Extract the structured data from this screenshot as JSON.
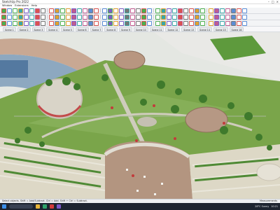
{
  "window": {
    "title": "SketchUp Pro 2022",
    "controls": [
      "–",
      "□",
      "×"
    ]
  },
  "menu": {
    "items": [
      "Window",
      "Extensions",
      "Help"
    ]
  },
  "toolbars": {
    "row1_icons": [
      "select-icon",
      "eraser-icon",
      "paint-icon",
      "line-icon",
      "arc-icon",
      "rectangle-icon",
      "circle-icon",
      "polygon-icon",
      "push-pull-icon",
      "move-icon",
      "rotate-icon",
      "scale-icon",
      "offset-icon",
      "tape-icon",
      "dimension-icon",
      "protractor-icon",
      "text-icon",
      "axes-icon",
      "3d-text-icon",
      "orbit-icon",
      "pan-icon",
      "zoom-icon",
      "zoom-extents-icon",
      "walk-icon",
      "look-around-icon",
      "section-icon",
      "component-icon",
      "group-icon",
      "layer-icon",
      "shadow-icon",
      "fog-icon",
      "style-icon",
      "scene-icon",
      "match-photo-icon",
      "sandbox-icon",
      "warehouse-icon",
      "extension-icon",
      "layout-icon",
      "styles-icon",
      "info-icon",
      "settings-icon",
      "help-icon"
    ],
    "row2_icons": [
      "iso-view-icon",
      "top-view-icon",
      "front-view-icon",
      "right-view-icon",
      "back-view-icon",
      "left-view-icon",
      "xray-icon",
      "back-edges-icon",
      "wireframe-icon",
      "hidden-line-icon",
      "shaded-icon",
      "textured-icon",
      "monochrome-icon",
      "section-plane-icon",
      "section-cut-icon",
      "section-fill-icon",
      "solid-union-icon",
      "solid-subtract-icon",
      "solid-trim-icon",
      "solid-intersect-icon",
      "outer-shell-icon",
      "split-icon",
      "curve-icon",
      "bezier-icon",
      "spline-icon",
      "joint-push-icon",
      "round-corner-icon",
      "shape-bender-icon",
      "follow-me-icon",
      "soften-icon",
      "smooth-icon",
      "weld-icon",
      "profile-icon",
      "extrude-icon",
      "loft-icon",
      "skin-icon",
      "quad-icon",
      "subdivide-icon",
      "random-icon",
      "array-icon",
      "mirror-icon",
      "align-icon"
    ],
    "row3_icons": [
      "tag-icon",
      "material-icon",
      "entity-icon",
      "outliner-icon",
      "components-icon",
      "scenes-icon",
      "styles-panel-icon",
      "shadows-panel-icon",
      "fog-panel-icon",
      "soften-panel-icon",
      "instructor-icon",
      "tray-icon",
      "render-icon",
      "light-icon",
      "camera-icon",
      "export-icon",
      "import-icon",
      "print-icon",
      "save-icon",
      "open-icon",
      "new-icon",
      "undo-icon",
      "redo-icon",
      "cut-icon",
      "copy-icon",
      "paste-icon",
      "delete-icon",
      "purge-icon",
      "report-icon",
      "animation-icon",
      "video-icon",
      "photo-icon",
      "sun-icon",
      "grass-icon",
      "tree-icon",
      "road-icon",
      "water-icon",
      "terrain-icon",
      "building-icon",
      "fence-icon",
      "lamp-icon",
      "bench-icon"
    ],
    "scene_tabs": [
      "Scene 1",
      "Scene 2",
      "Scene 3",
      "Scene 4",
      "Scene 5",
      "Scene 6",
      "Scene 7",
      "Scene 8",
      "Scene 9",
      "Scene 10",
      "Scene 11",
      "Scene 12",
      "Scene 13",
      "Scene 14",
      "Scene 15",
      "Scene 16"
    ]
  },
  "status": {
    "hint": "Select objects. Shift = Add/Subtract. Ctrl = Add. Shift + Ctrl = Subtract.",
    "measurements_label": "Measurements"
  },
  "taskbar": {
    "time": "10:21",
    "weather": "28°C  Sunny"
  },
  "colors": {
    "grass": "#6f9a3a",
    "path": "#c9c6b8",
    "plaza": "#b39580",
    "shrub": "#3f7a2c",
    "toolbar_bg": "#f3f4f6"
  }
}
